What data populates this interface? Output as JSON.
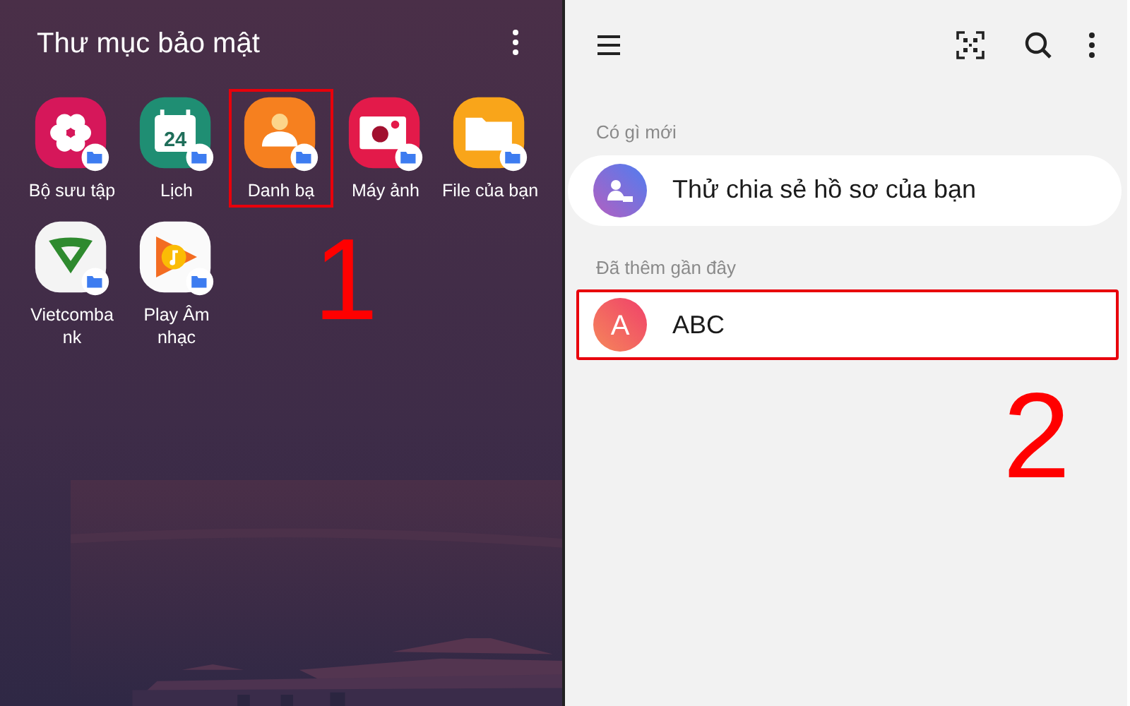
{
  "left_screen": {
    "title": "Thư mục bảo mật",
    "apps": [
      {
        "kind": "gallery",
        "label": "Bộ sưu tập",
        "highlighted": false
      },
      {
        "kind": "calendar",
        "label": "Lịch",
        "icon_text": "24",
        "highlighted": false
      },
      {
        "kind": "contacts",
        "label": "Danh bạ",
        "highlighted": true
      },
      {
        "kind": "camera",
        "label": "Máy ảnh",
        "highlighted": false
      },
      {
        "kind": "files",
        "label": "File của bạn",
        "highlighted": false
      },
      {
        "kind": "bank",
        "label": "Vietcomba nk",
        "highlighted": false
      },
      {
        "kind": "music",
        "label": "Play Âm nhạc",
        "highlighted": false
      }
    ],
    "step_number": "1"
  },
  "right_screen": {
    "sections": [
      {
        "heading": "Có gì mới",
        "items": [
          {
            "kind": "share",
            "text": "Thử chia sẻ hồ sơ của bạn",
            "highlighted": false
          }
        ]
      },
      {
        "heading": "Đã thêm gần đây",
        "items": [
          {
            "kind": "contact",
            "avatar_letter": "A",
            "text": "ABC",
            "highlighted": true
          }
        ]
      }
    ],
    "step_number": "2"
  }
}
